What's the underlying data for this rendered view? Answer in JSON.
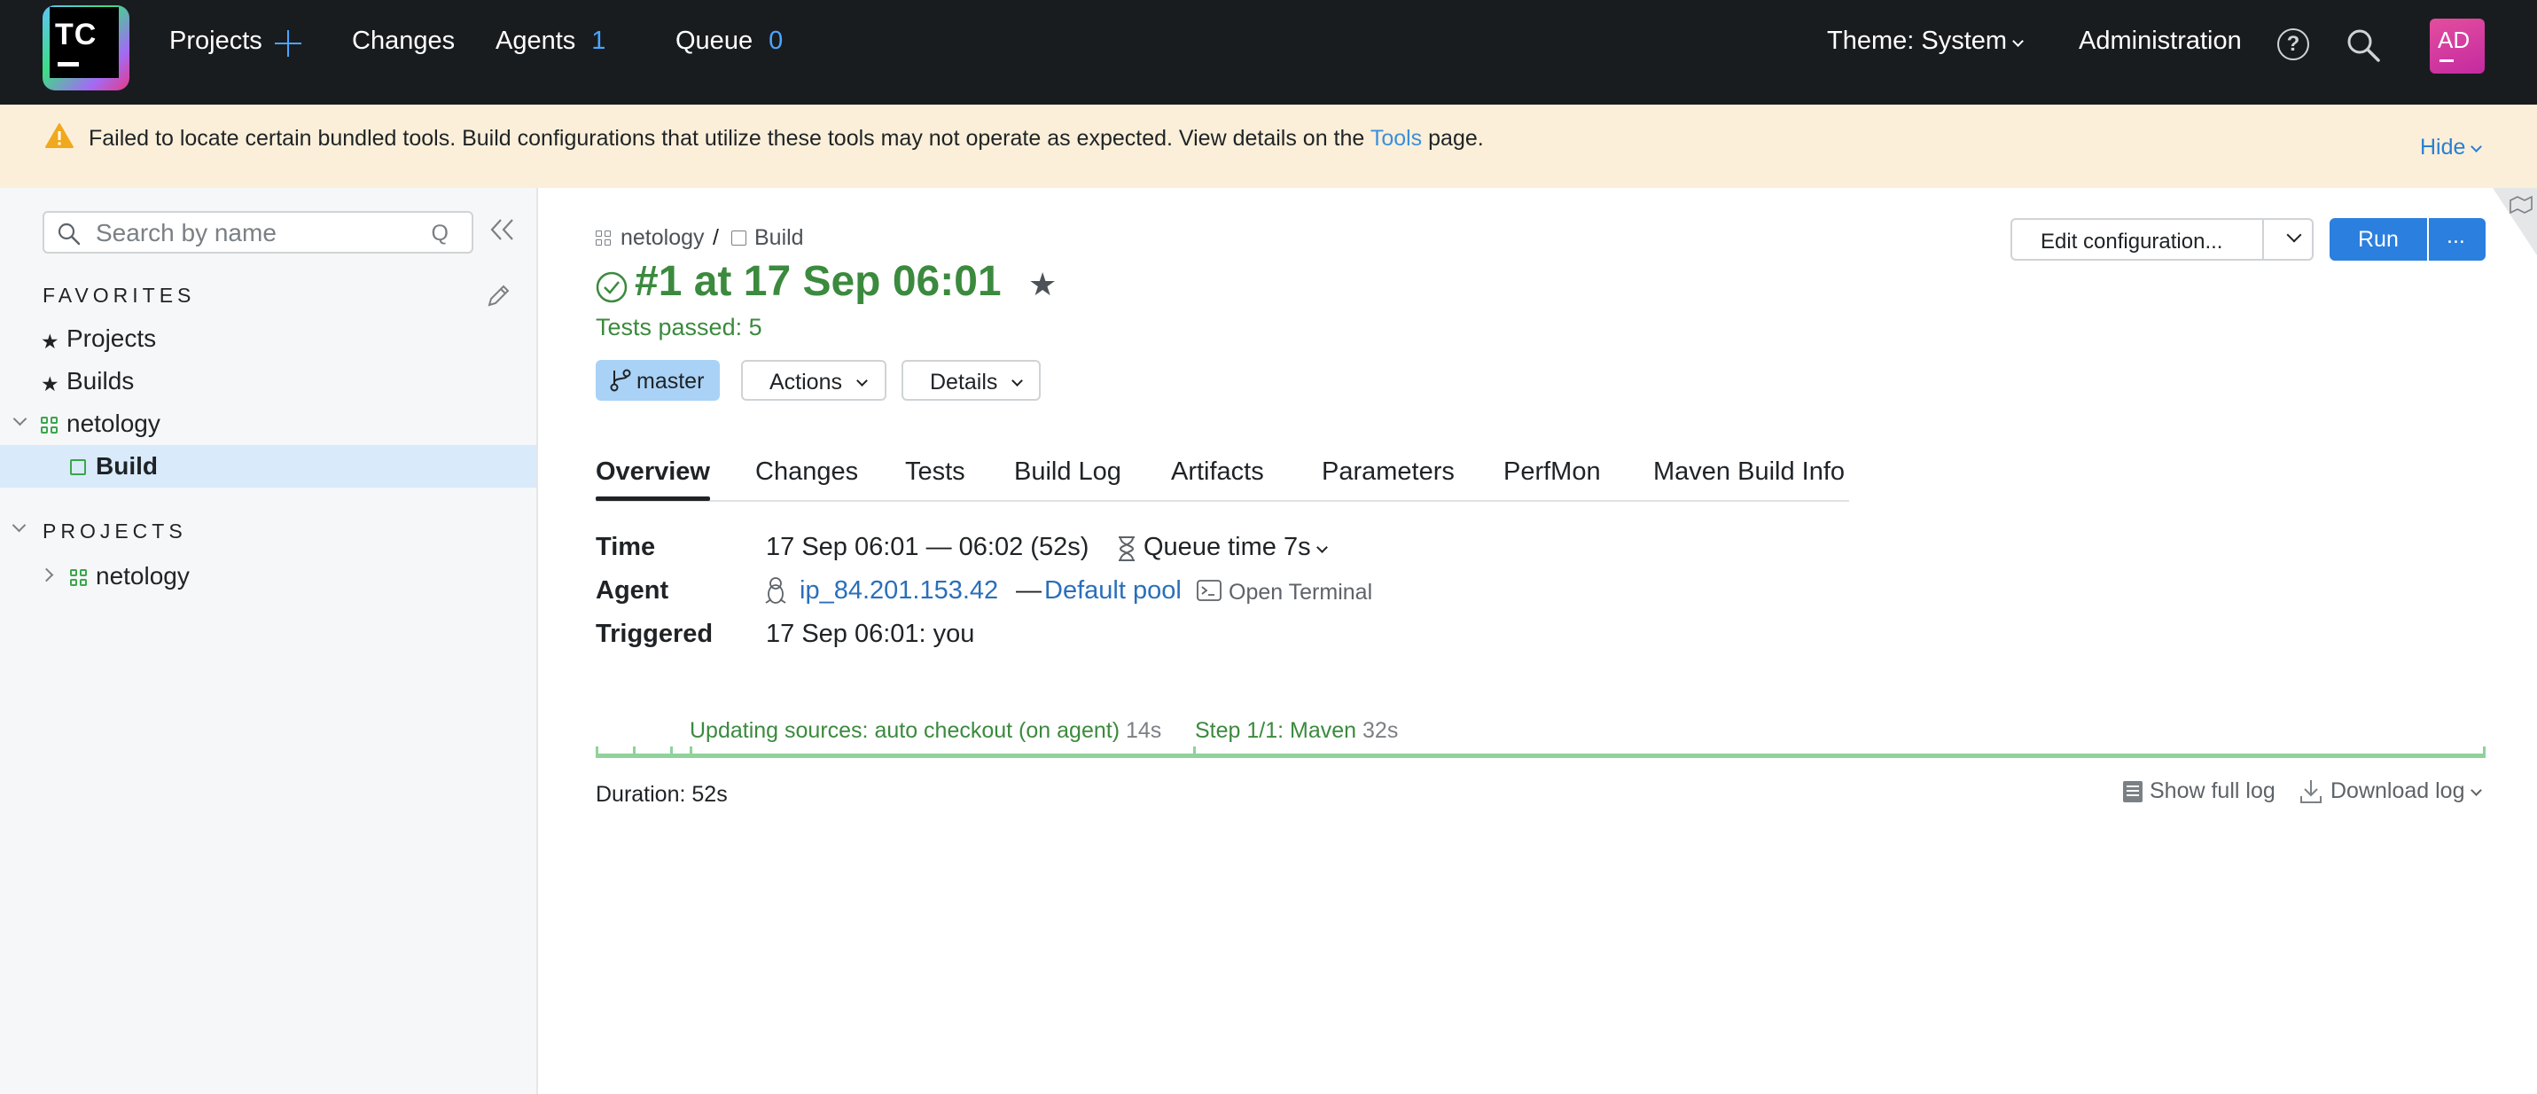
{
  "topbar": {
    "logo_text": "TC",
    "nav": {
      "projects": "Projects",
      "changes": "Changes",
      "agents": "Agents",
      "agents_count": "1",
      "queue": "Queue",
      "queue_count": "0"
    },
    "theme": "Theme: System",
    "administration": "Administration",
    "avatar_initials": "AD"
  },
  "banner": {
    "message_before": "Failed to locate certain bundled tools. Build configurations that utilize these tools may not operate as expected. View details on the ",
    "link": "Tools",
    "message_after": " page.",
    "hide": "Hide"
  },
  "sidebar": {
    "search_placeholder": "Search by name",
    "search_hotkey": "Q",
    "favorites_title": "FAVORITES",
    "favorites": [
      {
        "label": "Projects"
      },
      {
        "label": "Builds"
      },
      {
        "label": "netology"
      },
      {
        "label": "Build"
      }
    ],
    "projects_title": "PROJECTS",
    "projects": [
      {
        "label": "netology"
      }
    ]
  },
  "main": {
    "breadcrumb": {
      "project": "netology",
      "separator": "/",
      "config": "Build"
    },
    "title": "#1 at 17 Sep 06:01",
    "tests_passed": "Tests passed: 5",
    "branch": "master",
    "actions_label": "Actions",
    "details_label": "Details",
    "edit_configuration": "Edit configuration...",
    "run": "Run",
    "more": "...",
    "tabs": [
      "Overview",
      "Changes",
      "Tests",
      "Build Log",
      "Artifacts",
      "Parameters",
      "PerfMon",
      "Maven Build Info"
    ],
    "info": {
      "time_label": "Time",
      "time_value": "17 Sep 06:01 — 06:02 (52s)",
      "queue_time": "Queue time 7s",
      "agent_label": "Agent",
      "agent_name": "ip_84.201.153.42",
      "agent_sep": "—",
      "agent_pool": "Default pool",
      "open_terminal": "Open Terminal",
      "triggered_label": "Triggered",
      "triggered_value": "17 Sep 06:01: you"
    },
    "timeline": {
      "step1_label": "Updating sources: auto checkout (on agent)",
      "step1_duration": "14s",
      "step2_label": "Step 1/1: Maven",
      "step2_duration": "32s"
    },
    "duration": "Duration: 52s",
    "show_full_log": "Show full log",
    "download_log": "Download log"
  },
  "colors": {
    "accent": "#2b7fde",
    "success": "#3b8a3e",
    "banner_bg": "#fbefd9",
    "topbar_bg": "#191c1f"
  }
}
